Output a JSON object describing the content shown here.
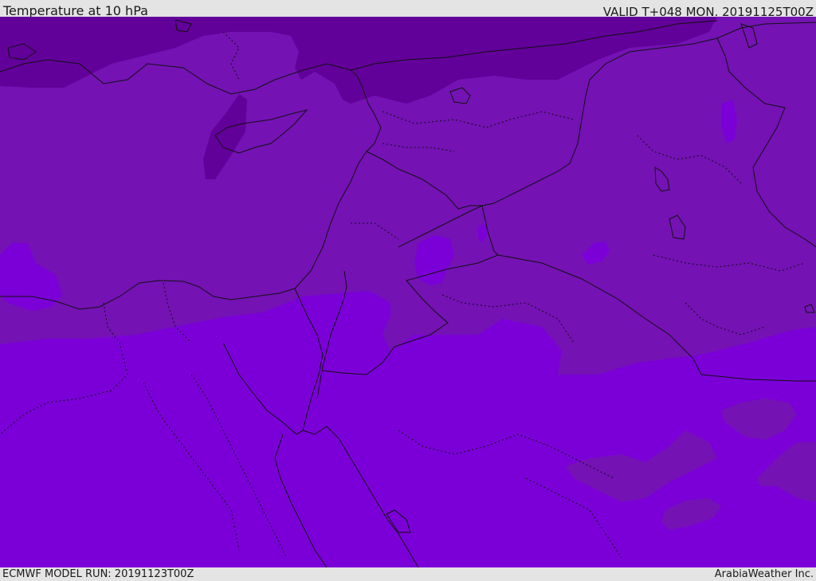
{
  "header": {
    "title": "Temperature at 10 hPa",
    "valid": "VALID T+048 MON. 20191125T00Z"
  },
  "footer": {
    "model_run": "ECMWF MODEL RUN: 20191123T00Z",
    "credit": "ArabiaWeather Inc."
  },
  "map": {
    "colors": {
      "band_coldest": "#62009a",
      "band_mid": "#7412b4",
      "band_warm": "#7b00d8",
      "band_light": "#7f00e4",
      "coast": "#111111"
    }
  }
}
